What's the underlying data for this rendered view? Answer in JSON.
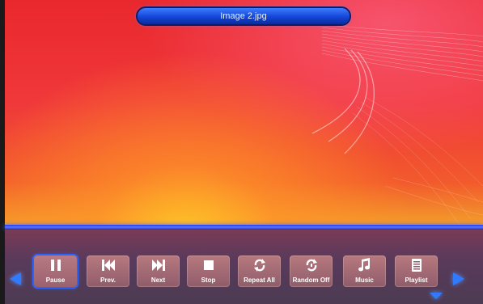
{
  "title": {
    "filename": "Image 2.jpg"
  },
  "controls": [
    {
      "label": "Pause",
      "icon": "pause-icon",
      "selected": true
    },
    {
      "label": "Prev.",
      "icon": "previous-icon"
    },
    {
      "label": "Next",
      "icon": "next-icon"
    },
    {
      "label": "Stop",
      "icon": "stop-icon"
    },
    {
      "label": "Repeat All",
      "icon": "repeat-icon"
    },
    {
      "label": "Random Off",
      "icon": "random-icon"
    },
    {
      "label": "Music",
      "icon": "music-note-icon"
    },
    {
      "label": "Playlist",
      "icon": "playlist-icon"
    }
  ],
  "colors": {
    "accent_blue": "#2f7bff",
    "control_bar": "#5a3a5c",
    "image_red": "#e9282d",
    "image_orange": "#f3a22a"
  }
}
